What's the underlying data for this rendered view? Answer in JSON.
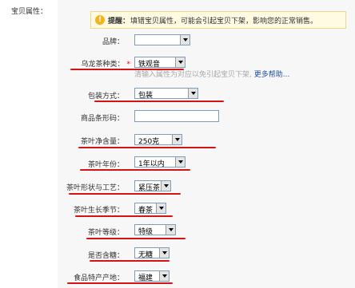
{
  "section_label": "宝贝属性：",
  "tip": {
    "title": "提醒：",
    "text": "填错宝贝属性，可能会引起宝贝下架，影响您的正常销售。"
  },
  "hint": {
    "text": "清输入属性为对应以免引起宝贝下架,",
    "link": "更多帮助..."
  },
  "fields": {
    "brand": {
      "label": "品牌：",
      "value": ""
    },
    "oolong_type": {
      "label": "乌龙茶种类：",
      "required_mark": "*",
      "value": "铁观音"
    },
    "packaging": {
      "label": "包装方式：",
      "value": "包装"
    },
    "barcode": {
      "label": "商品条形码：",
      "value": ""
    },
    "net_weight": {
      "label": "茶叶净含量：",
      "value": "250克"
    },
    "tea_year": {
      "label": "茶叶年份：",
      "value": "1年以内"
    },
    "shape_craft": {
      "label": "茶叶形状与工艺：",
      "value": "紧压茶"
    },
    "season": {
      "label": "茶叶生长季节：",
      "value": "春茶"
    },
    "grade": {
      "label": "茶叶等级：",
      "value": "特级"
    },
    "sugar": {
      "label": "是否含糖：",
      "value": "无糖"
    },
    "origin": {
      "label": "食品特产产地：",
      "value": "福建"
    }
  },
  "colors": {
    "annotation_red": "#d21414",
    "tip_background": "#fffbe2",
    "link_blue": "#1f4fa3"
  }
}
